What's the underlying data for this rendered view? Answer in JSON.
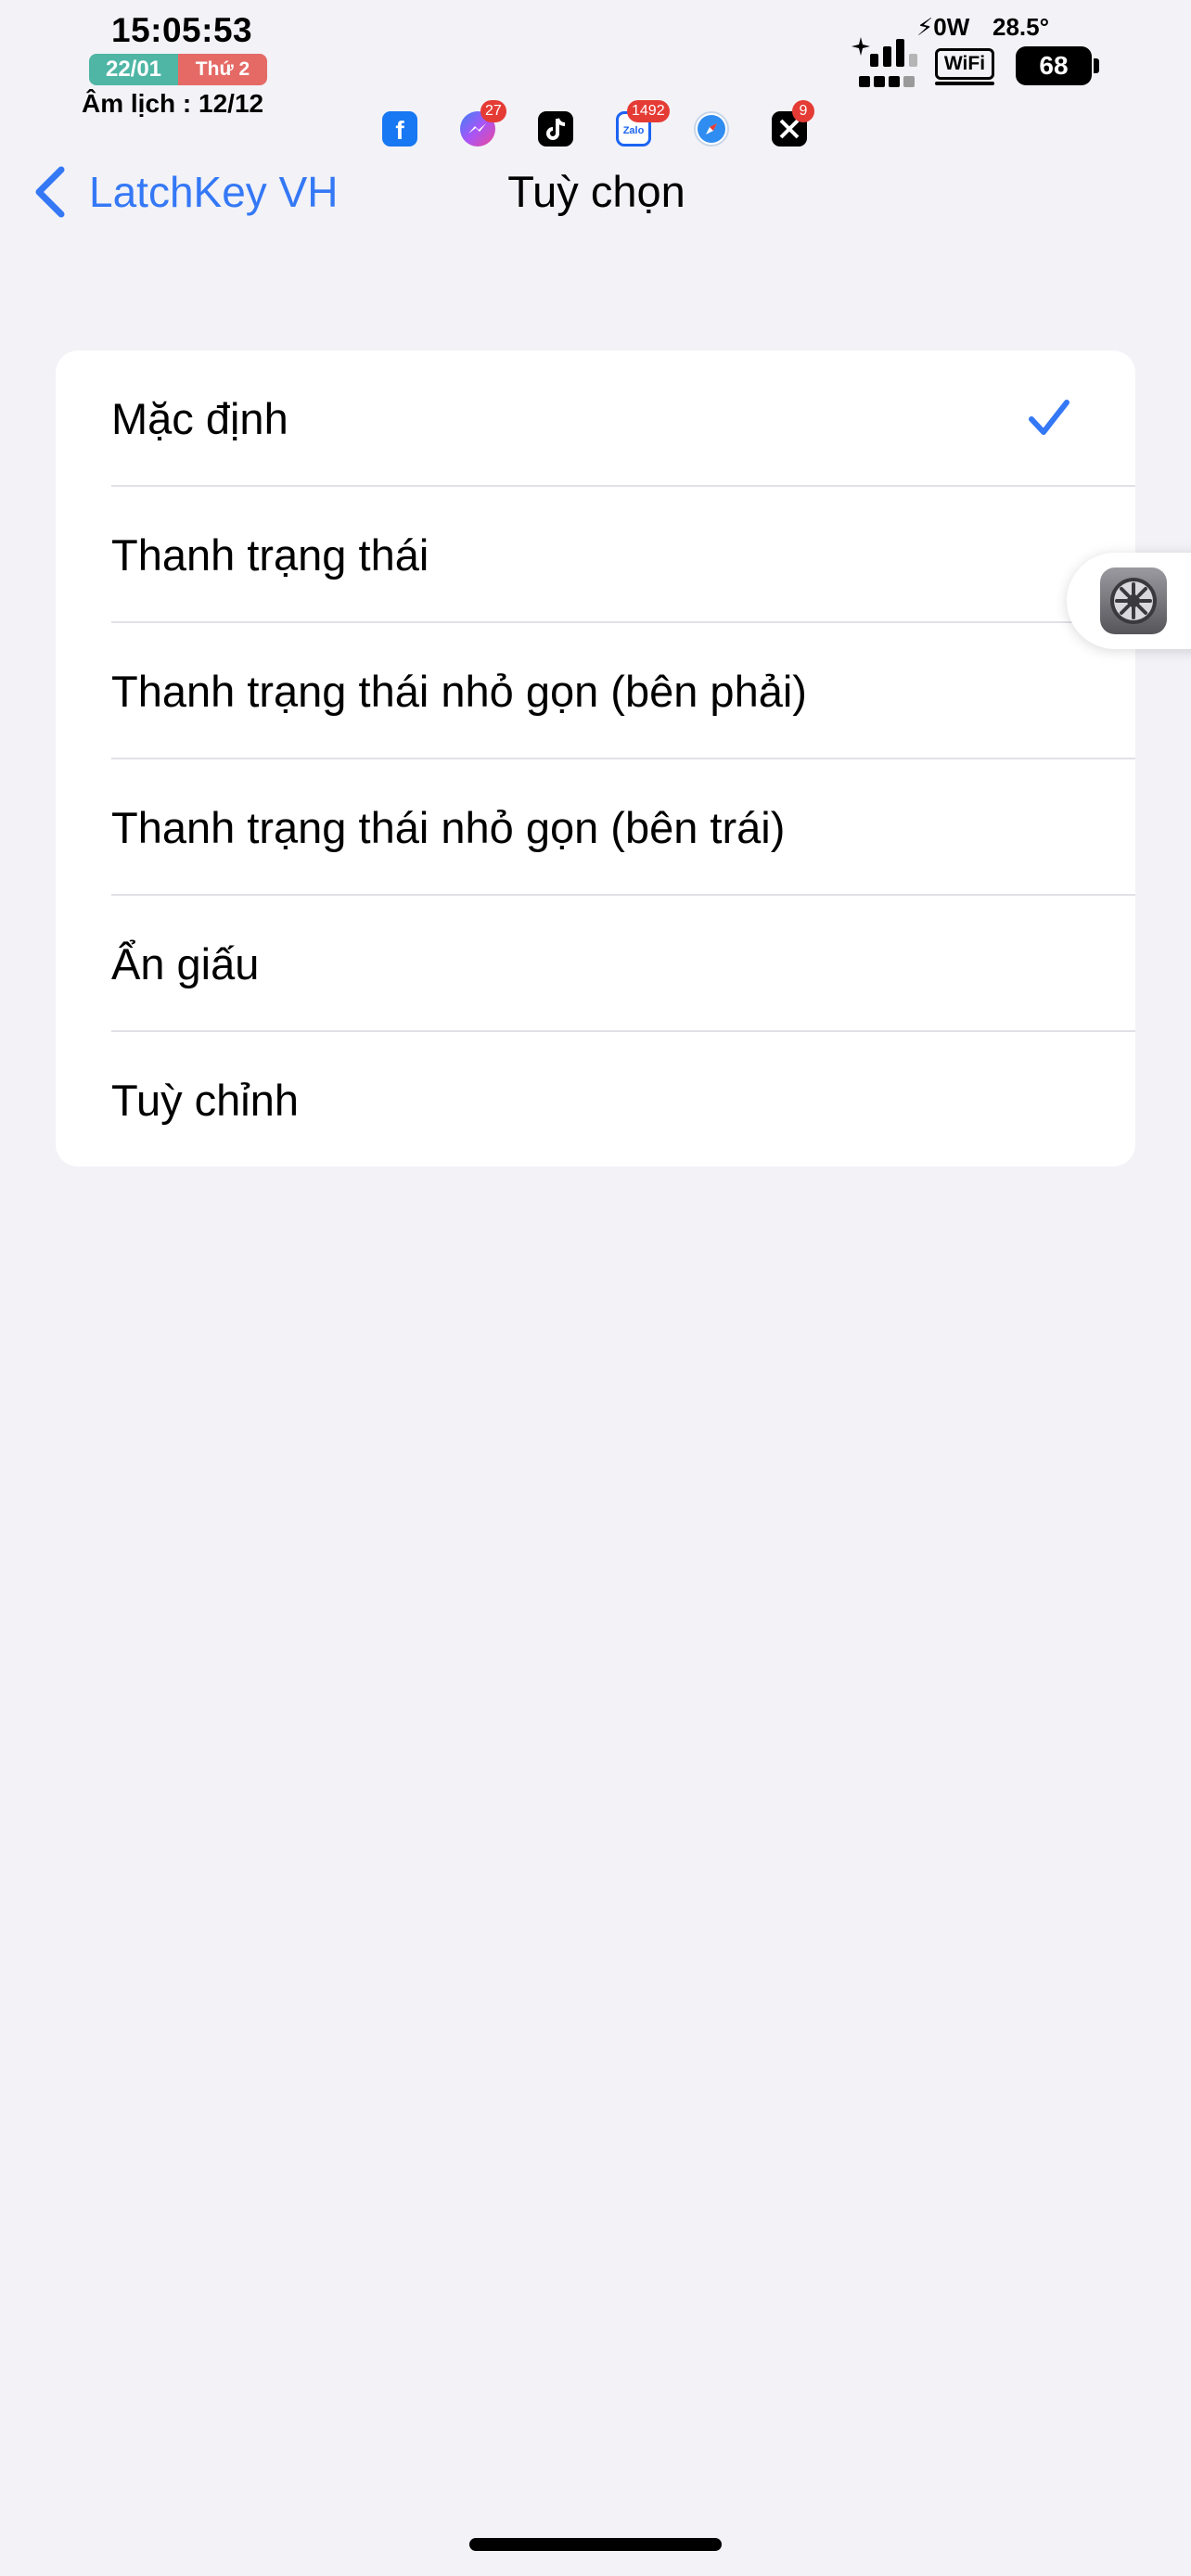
{
  "status_bar": {
    "time": "15:05:53",
    "date": "22/01",
    "weekday": "Thứ 2",
    "lunar": "Âm lịch : 12/12",
    "power": "⚡0W",
    "temperature": "28.5°",
    "wifi": "WiFi",
    "battery": "68",
    "apps": [
      {
        "name": "facebook",
        "badge": ""
      },
      {
        "name": "messenger",
        "badge": "27"
      },
      {
        "name": "tiktok",
        "badge": ""
      },
      {
        "name": "zalo",
        "badge": "1492"
      },
      {
        "name": "safari",
        "badge": ""
      },
      {
        "name": "x",
        "badge": "9"
      }
    ]
  },
  "nav": {
    "back_label": "LatchKey VH",
    "title": "Tuỳ chọn"
  },
  "options": [
    {
      "label": "Mặc định",
      "selected": true
    },
    {
      "label": "Thanh trạng thái",
      "selected": false
    },
    {
      "label": "Thanh trạng thái nhỏ gọn (bên phải)",
      "selected": false
    },
    {
      "label": "Thanh trạng thái nhỏ gọn (bên trái)",
      "selected": false
    },
    {
      "label": "Ẩn giấu",
      "selected": false
    },
    {
      "label": "Tuỳ chỉnh",
      "selected": false
    }
  ],
  "colors": {
    "accent": "#3478f6",
    "background": "#f2f2f7",
    "date_pill": "#4fb6a5",
    "weekday_pill": "#e56a66"
  }
}
